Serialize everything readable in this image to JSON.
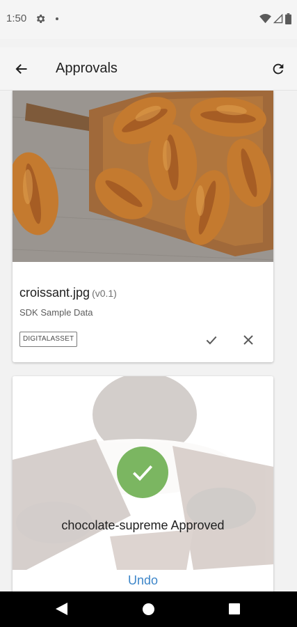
{
  "status_bar": {
    "time": "1:50"
  },
  "app_bar": {
    "title": "Approvals"
  },
  "assets": [
    {
      "file_name": "croissant.jpg",
      "version": "(v0.1)",
      "source": "SDK Sample Data",
      "type_badge": "DIGITALASSET"
    }
  ],
  "approved_asset": {
    "message": "chocolate-supreme Approved",
    "undo_label": "Undo"
  },
  "colors": {
    "approved_green": "#7bb661",
    "undo_blue": "#3d86c9",
    "app_bar_bg": "#f5f5f5"
  },
  "icons": [
    "gear-icon",
    "wifi-icon",
    "signal-icon",
    "battery-icon",
    "back-arrow-icon",
    "refresh-icon",
    "checkmark-icon",
    "close-icon",
    "nav-back-icon",
    "nav-home-icon",
    "nav-recents-icon"
  ]
}
